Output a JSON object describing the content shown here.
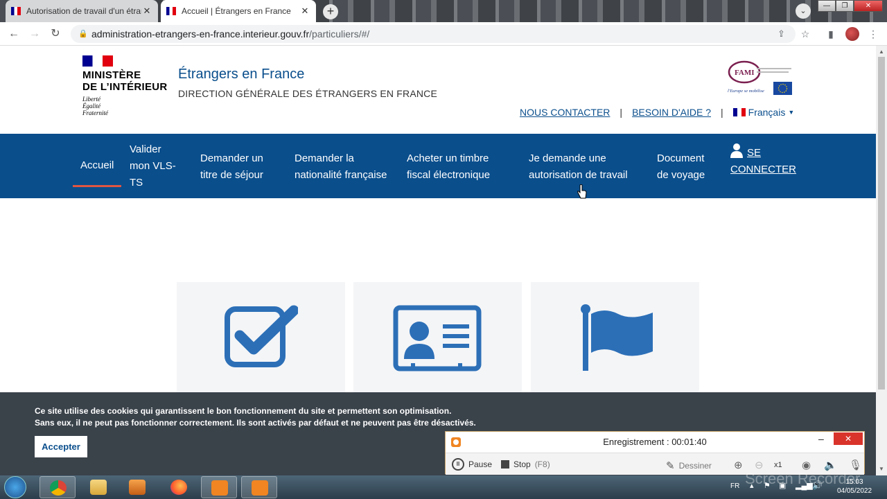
{
  "browser": {
    "tabs": [
      {
        "title": "Autorisation de travail d'un étran",
        "active": false
      },
      {
        "title": "Accueil | Étrangers en France",
        "active": true
      }
    ],
    "url_host": "administration-etrangers-en-france.interieur.gouv.fr",
    "url_path": "/particuliers/#/"
  },
  "header": {
    "ministry_line1": "MINISTÈRE",
    "ministry_line2": "DE L’INTÉRIEUR",
    "motto1": "Liberté",
    "motto2": "Égalité",
    "motto3": "Fraternité",
    "site_title": "Étrangers en France",
    "site_subtitle": "DIRECTION GÉNÉRALE DES ÉTRANGERS EN FRANCE",
    "partner_logo_text": "FAMI",
    "partner_tagline": "l'Europe se mobilise",
    "contact": "NOUS CONTACTER",
    "help": "BESOIN D'AIDE ?",
    "separator": "|",
    "language": "Français"
  },
  "nav": {
    "items": [
      {
        "line1": "Accueil",
        "line2": "",
        "line3": ""
      },
      {
        "line1": "Valider",
        "line2": "mon VLS-",
        "line3": "TS"
      },
      {
        "line1": "Demander un",
        "line2": "titre de séjour",
        "line3": ""
      },
      {
        "line1": "Demander la",
        "line2": "nationalité française",
        "line3": ""
      },
      {
        "line1": "Acheter un timbre",
        "line2": "fiscal électronique",
        "line3": ""
      },
      {
        "line1": "Je demande une",
        "line2": "autorisation de travail",
        "line3": ""
      },
      {
        "line1": "Document",
        "line2": "de voyage",
        "line3": ""
      }
    ],
    "login_line1": "SE",
    "login_line2": "CONNECTER"
  },
  "cards": [
    {
      "icon": "checkbox-icon"
    },
    {
      "icon": "id-card-icon"
    },
    {
      "icon": "flag-icon"
    }
  ],
  "cookie": {
    "line1": "Ce site utilise des cookies qui garantissent le bon fonctionnement du site et permettent son optimisation.",
    "line2": "Sans eux, il ne peut pas fonctionner correctement. Ils sont activés par défaut et ne peuvent pas être désactivés.",
    "accept": "Accepter"
  },
  "recorder": {
    "status": "Enregistrement : 00:01:40",
    "pause": "Pause",
    "stop": "Stop",
    "stop_shortcut": "(F8)",
    "draw": "Dessiner",
    "zoom": "x1",
    "watermark": "Screen Recorder"
  },
  "taskbar": {
    "lang": "FR",
    "time": "15:03",
    "date": "04/05/2022"
  },
  "colors": {
    "primary_blue": "#0a4e8c",
    "icon_blue": "#2c6fb7",
    "active_underline": "#e05642",
    "cookie_bg": "#3a424a",
    "recorder_accent": "#f08522"
  }
}
